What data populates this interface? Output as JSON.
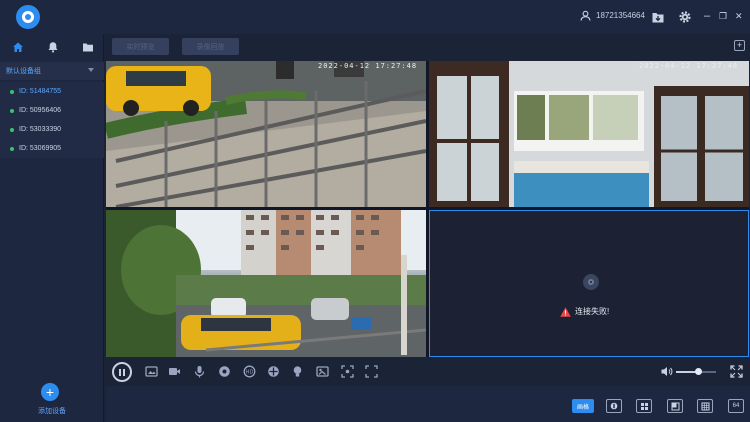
{
  "header": {
    "phone": "18721354664",
    "minimize": "–",
    "restore": "❐",
    "close": "✕"
  },
  "sidebar": {
    "group_label": "默认设备组",
    "devices": [
      {
        "label": "ID: 51484755"
      },
      {
        "label": "ID: 50956406"
      },
      {
        "label": "ID: 53033390"
      },
      {
        "label": "ID: 53069905"
      }
    ],
    "add_label": "添加设备",
    "add_symbol": "+"
  },
  "toolbar": {
    "btn1": "实时预览",
    "btn2": "录像回放",
    "plus": "+"
  },
  "videos": {
    "tile1_timestamp": "2022-04-12 17:27:48",
    "tile2_timestamp": "2022-04-12 17:27:48",
    "tile4_error": "连接失败!"
  },
  "controls": {
    "volume_fraction": 0.55
  },
  "layouts": {
    "active": "画格",
    "count_16": "64"
  },
  "colors": {
    "accent": "#2d8cf0",
    "bg": "#1b2337",
    "panel": "#1e2740",
    "warning": "#e5484d"
  }
}
